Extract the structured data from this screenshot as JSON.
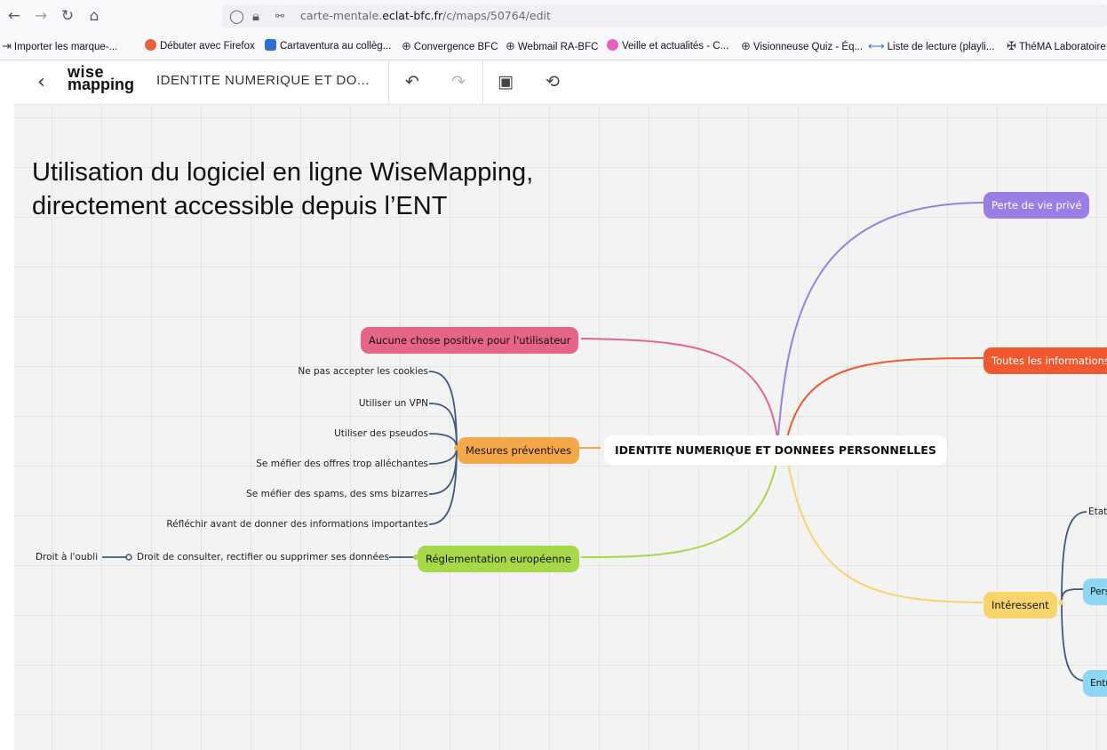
{
  "browser": {
    "url_prefix": "carte-mentale.",
    "url_domain": "eclat-bfc.fr",
    "url_path": "/c/maps/50764/edit",
    "bookmarks": [
      "Importer les marque-...",
      "Débuter avec Firefox",
      "Cartaventura au collèg...",
      "Convergence BFC",
      "Webmail RA-BFC",
      "Veille et actualités - C...",
      "Visionneuse Quiz - Éq...",
      "Liste de lecture (playli...",
      "ThéMA Laboratoire"
    ]
  },
  "toolbar": {
    "logo_line1": "wise",
    "logo_line2": "mapping",
    "map_title": "IDENTITE NUMERIQUE ET DO..."
  },
  "overlay": {
    "line1": "Utilisation du logiciel en ligne WiseMapping,",
    "line2": "directement accessible depuis l’ENT"
  },
  "mindmap": {
    "central": "IDENTITE NUMERIQUE ET DONNEES PERSONNELLES",
    "topics": {
      "perte": "Perte de vie privé",
      "toutes": "Toutes les informations",
      "aucune": "Aucune chose positive pour l'utilisateur",
      "mesures": "Mesures préventives",
      "reglementation": "Réglementation européenne",
      "interessent": "Intéressent"
    },
    "mesures_children": [
      "Ne pas accepter les cookies",
      "Utiliser un VPN",
      "Utiliser des pseudos",
      "Se méfier des offres trop alléchantes",
      "Se méfier des spams, des sms bizarres",
      "Réfléchir avant de donner des informations importantes"
    ],
    "reglementation_child": "Droit de consulter, rectifier ou supprimer ses données",
    "reglementation_grandchild": "Droit à l'oubli",
    "interessent_children": [
      "Etat",
      "Pers",
      "Entr"
    ]
  },
  "colors": {
    "perte": "#9b7de6",
    "toutes": "#f0582f",
    "aucune": "#e66586",
    "mesures": "#f5a84a",
    "reglementation": "#a7d84a",
    "interessent": "#f7d56a",
    "child_link": "#3e5a80",
    "light_blue": "#8fd6f5"
  }
}
